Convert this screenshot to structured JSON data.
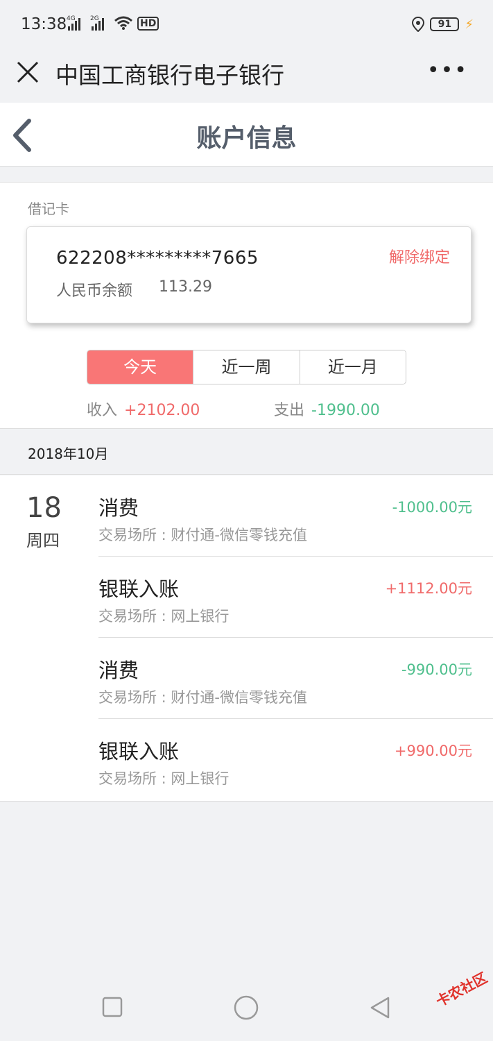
{
  "status_bar": {
    "time": "13:38",
    "net1": "4G",
    "net2": "2G",
    "hd": "HD",
    "battery": "91"
  },
  "app_bar": {
    "title": "中国工商银行电子银行",
    "more": "•••"
  },
  "page": {
    "title": "账户信息"
  },
  "card": {
    "type_label": "借记卡",
    "number": "622208*********7665",
    "unbind_label": "解除绑定",
    "balance_label": "人民币余额",
    "balance": "113.29"
  },
  "tabs": [
    {
      "label": "今天",
      "active": true
    },
    {
      "label": "近一周",
      "active": false
    },
    {
      "label": "近一月",
      "active": false
    }
  ],
  "summary": {
    "income_label": "收入",
    "income": "+2102.00",
    "expense_label": "支出",
    "expense": "-1990.00"
  },
  "month": "2018年10月",
  "date": {
    "day": "18",
    "weekday": "周四"
  },
  "transactions": [
    {
      "title": "消费",
      "place": "交易场所 : 财付通-微信零钱充值",
      "amount": "-1000.00元"
    },
    {
      "title": "银联入账",
      "place": "交易场所 : 网上银行",
      "amount": "+1112.00元"
    },
    {
      "title": "消费",
      "place": "交易场所 : 财付通-微信零钱充值",
      "amount": "-990.00元"
    },
    {
      "title": "银联入账",
      "place": "交易场所 : 网上银行",
      "amount": "+990.00元"
    }
  ],
  "watermark": "卡农社区",
  "colors": {
    "accent": "#f97676",
    "income": "#f06a6a",
    "expense": "#4fbf8d",
    "title": "#555e6b"
  }
}
